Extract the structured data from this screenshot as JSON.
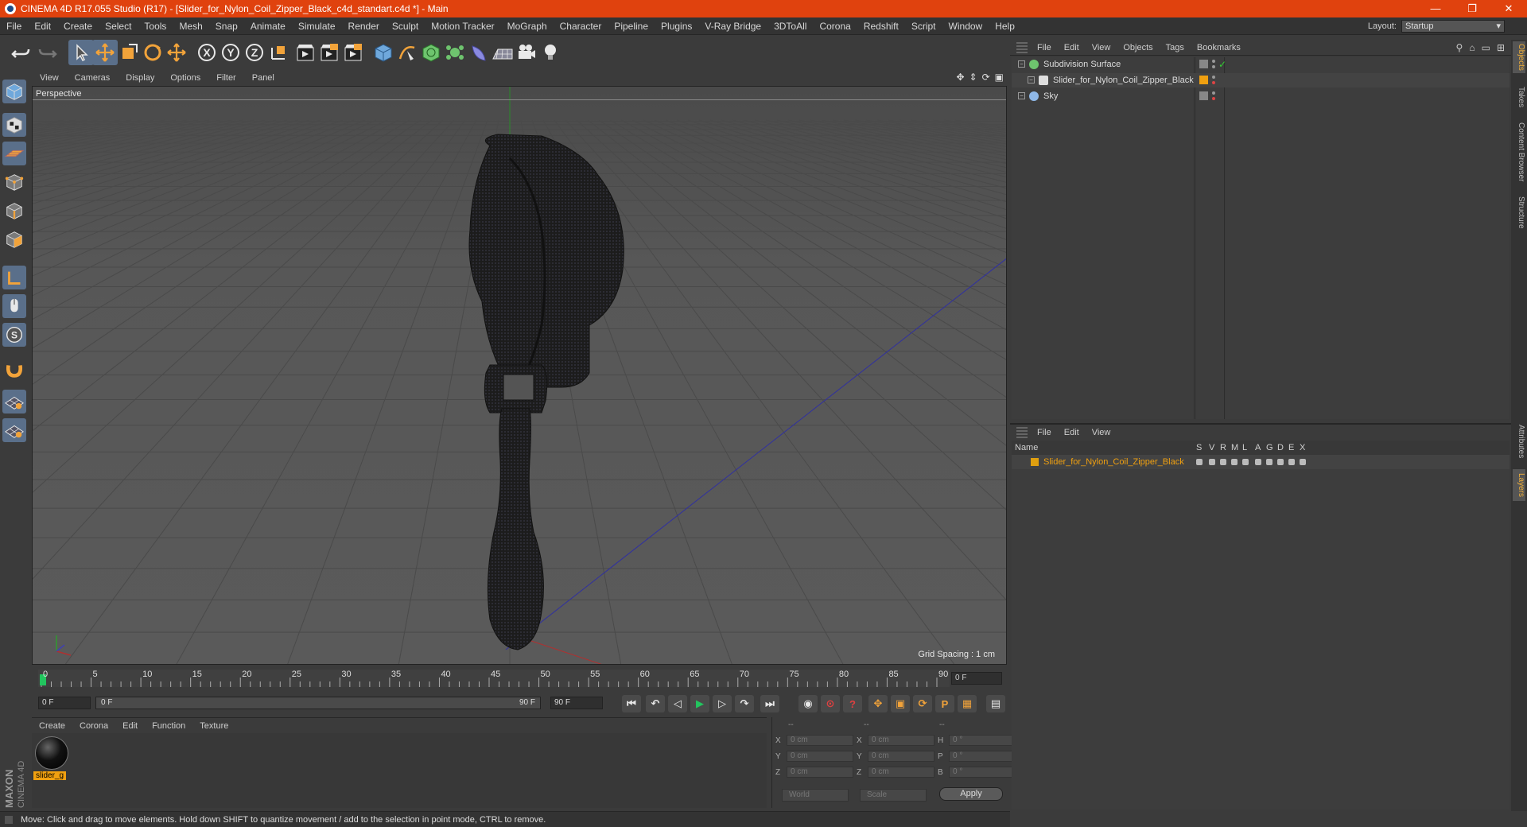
{
  "window": {
    "title": "CINEMA 4D R17.055 Studio (R17) - [Slider_for_Nylon_Coil_Zipper_Black_c4d_standart.c4d *] - Main",
    "controls": [
      "—",
      "❐",
      "✕"
    ]
  },
  "menubar": {
    "items": [
      "File",
      "Edit",
      "Create",
      "Select",
      "Tools",
      "Mesh",
      "Snap",
      "Animate",
      "Simulate",
      "Render",
      "Sculpt",
      "Motion Tracker",
      "MoGraph",
      "Character",
      "Pipeline",
      "Plugins",
      "V-Ray Bridge",
      "3DToAll",
      "Corona",
      "Redshift",
      "Script",
      "Window",
      "Help"
    ],
    "layout_label": "Layout:",
    "layout_value": "Startup"
  },
  "toolbar": {
    "icons": [
      "undo-icon",
      "redo-icon",
      "select-arrow-icon",
      "move-icon",
      "scale-icon",
      "rotate-icon",
      "move-axis-icon",
      "x-axis-icon",
      "y-axis-icon",
      "z-axis-icon",
      "coordinate-system-icon",
      "render-view-icon",
      "render-picture-viewer-icon",
      "edit-render-settings-icon",
      "cube-primitive-icon",
      "pen-spline-icon",
      "subdivision-surface-icon",
      "cloner-icon",
      "deformer-icon",
      "floor-icon",
      "camera-icon",
      "light-icon"
    ],
    "axis_letters": [
      "X",
      "Y",
      "Z"
    ]
  },
  "left_tools": [
    "model-mode-icon",
    "texture-mode-icon",
    "workplane-mode-icon",
    "points-mode-icon",
    "edges-mode-icon",
    "polygons-mode-icon",
    "axis-mode-icon",
    "tweak-mode-icon",
    "solo-mode-icon",
    "magnet-icon",
    "snap-grid-icon",
    "snap-settings-icon"
  ],
  "viewport": {
    "menu": [
      "View",
      "Cameras",
      "Display",
      "Options",
      "Filter",
      "Panel"
    ],
    "label": "Perspective",
    "grid_spacing": "Grid Spacing : 1 cm"
  },
  "timeline": {
    "ticks": [
      "0",
      "5",
      "10",
      "15",
      "20",
      "25",
      "30",
      "35",
      "40",
      "45",
      "50",
      "55",
      "60",
      "65",
      "70",
      "75",
      "80",
      "85",
      "90"
    ],
    "current_frame": "0 F",
    "start_frame": "0 F",
    "range_start": "0 F",
    "range_end": "90 F",
    "end_frame": "90 F"
  },
  "material_manager": {
    "menu": [
      "Create",
      "Corona",
      "Edit",
      "Function",
      "Texture"
    ],
    "material_name": "slider_g"
  },
  "coordinates": {
    "header": [
      "--",
      "--",
      "--"
    ],
    "rows": [
      {
        "pos_label": "X",
        "pos_value": "0 cm",
        "size_label": "X",
        "size_value": "0 cm",
        "rot_label": "H",
        "rot_value": "0 °"
      },
      {
        "pos_label": "Y",
        "pos_value": "0 cm",
        "size_label": "Y",
        "size_value": "0 cm",
        "rot_label": "P",
        "rot_value": "0 °"
      },
      {
        "pos_label": "Z",
        "pos_value": "0 cm",
        "size_label": "Z",
        "size_value": "0 cm",
        "rot_label": "B",
        "rot_value": "0 °"
      }
    ],
    "mode_world": "World",
    "mode_scale": "Scale",
    "apply": "Apply"
  },
  "status_bar": {
    "text": "Move: Click and drag to move elements. Hold down SHIFT to quantize movement / add to the selection in point mode, CTRL to remove."
  },
  "brand": {
    "maxon": "MAXON",
    "cinema": "CINEMA 4D"
  },
  "object_manager": {
    "menu": [
      "File",
      "Edit",
      "View",
      "Objects",
      "Tags",
      "Bookmarks"
    ],
    "objects": [
      {
        "name": "Subdivision Surface",
        "icon": "subdivision-icon",
        "indent": 0
      },
      {
        "name": "Slider_for_Nylon_Coil_Zipper_Black",
        "icon": "null-object-icon",
        "indent": 1
      },
      {
        "name": "Sky",
        "icon": "sky-icon",
        "indent": 0
      }
    ]
  },
  "layer_manager": {
    "menu": [
      "File",
      "Edit",
      "View"
    ],
    "columns": [
      "Name",
      "S",
      "V",
      "R",
      "M",
      "L",
      "A",
      "G",
      "D",
      "E",
      "X"
    ],
    "layers": [
      {
        "name": "Slider_for_Nylon_Coil_Zipper_Black",
        "color": "#e0a010"
      }
    ]
  },
  "right_tabs": [
    "Objects",
    "Takes",
    "Content Browser",
    "Structure",
    "Attributes",
    "Layers"
  ],
  "colors": {
    "titlebar": "#e0420e",
    "accent": "#f0a010",
    "active_tool": "#5a6f8a"
  }
}
